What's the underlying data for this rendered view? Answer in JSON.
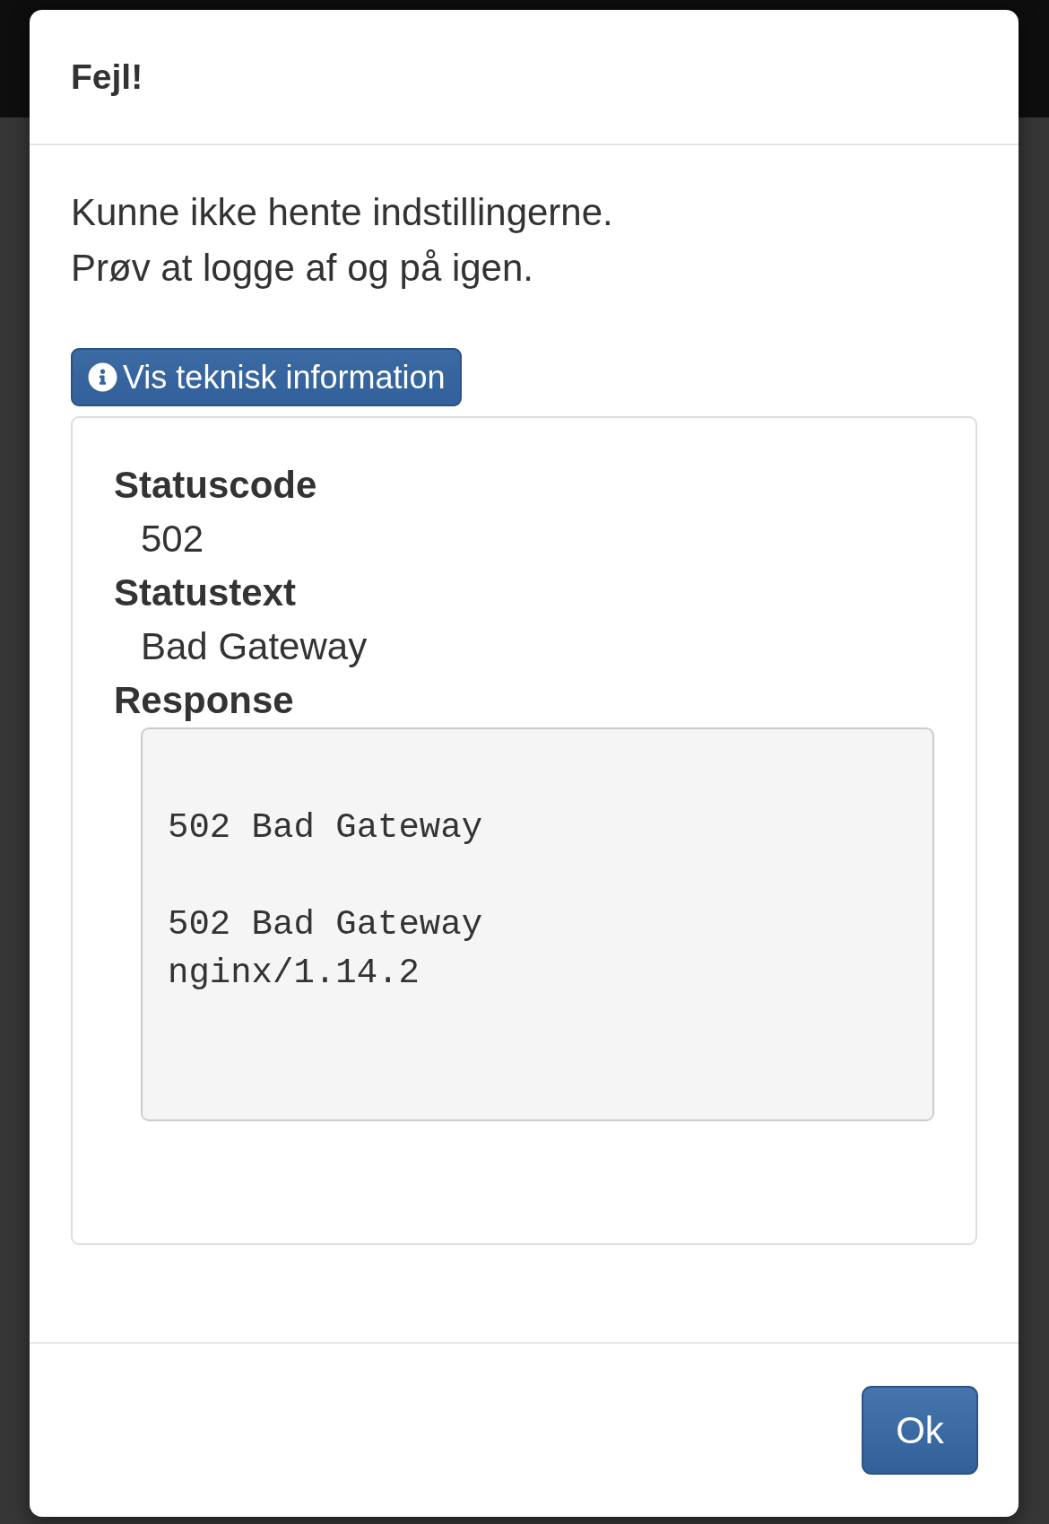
{
  "dialog": {
    "title": "Fejl!",
    "message": [
      "Kunne ikke hente indstillingerne.",
      "Prøv at logge af og på igen."
    ],
    "details_button": {
      "label": "Vis teknisk information",
      "expanded": true
    },
    "details": [
      {
        "kind": "text",
        "term": "Statuscode",
        "value": "502"
      },
      {
        "kind": "text",
        "term": "Statustext",
        "value": "Bad Gateway"
      },
      {
        "kind": "code",
        "term": "Response",
        "value": "502 Bad Gateway\n\n502 Bad Gateway\nnginx/1.14.2"
      }
    ],
    "buttons": [
      {
        "label": "Ok"
      }
    ]
  }
}
